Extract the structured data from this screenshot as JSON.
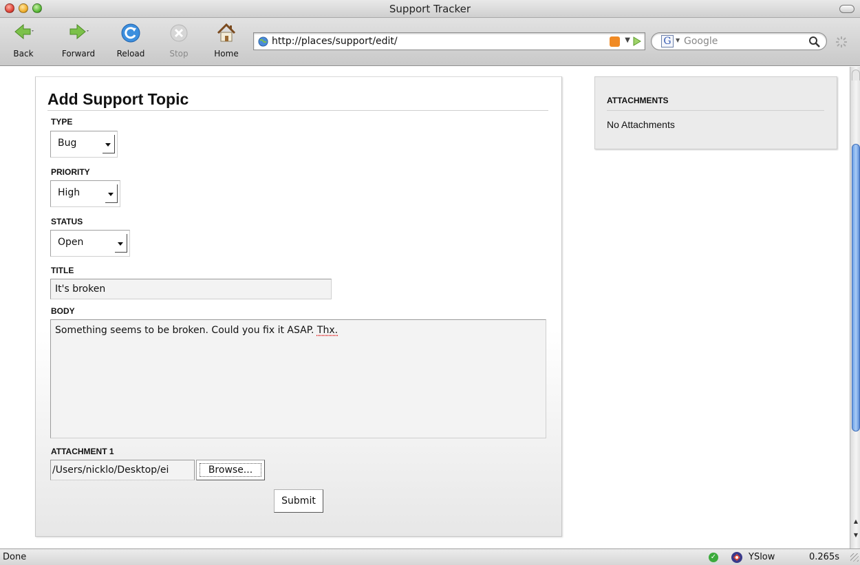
{
  "window": {
    "title": "Support Tracker"
  },
  "toolbar": {
    "back_label": "Back",
    "forward_label": "Forward",
    "reload_label": "Reload",
    "stop_label": "Stop",
    "home_label": "Home",
    "url": "http://places/support/edit/",
    "search_placeholder": "Google",
    "search_engine_letter": "G"
  },
  "form": {
    "heading": "Add Support Topic",
    "type_label": "TYPE",
    "type_value": "Bug",
    "priority_label": "PRIORITY",
    "priority_value": "High",
    "status_label": "STATUS",
    "status_value": "Open",
    "title_label": "TITLE",
    "title_value": "It's broken",
    "body_label": "BODY",
    "body_text": "Something seems to be broken. Could you fix it ASAP.",
    "body_flagged_word": "Thx.",
    "attachment_label": "ATTACHMENT 1",
    "attachment_path": "/Users/nicklo/Desktop/ei",
    "browse_label": "Browse...",
    "submit_label": "Submit"
  },
  "sidebar": {
    "title": "ATTACHMENTS",
    "empty_text": "No Attachments"
  },
  "statusbar": {
    "status": "Done",
    "yslow_label": "YSlow",
    "load_time": "0.265s"
  },
  "colors": {
    "accent_blue": "#5f8fd9",
    "rss_orange": "#f08a24",
    "ok_green": "#3caa3c"
  }
}
